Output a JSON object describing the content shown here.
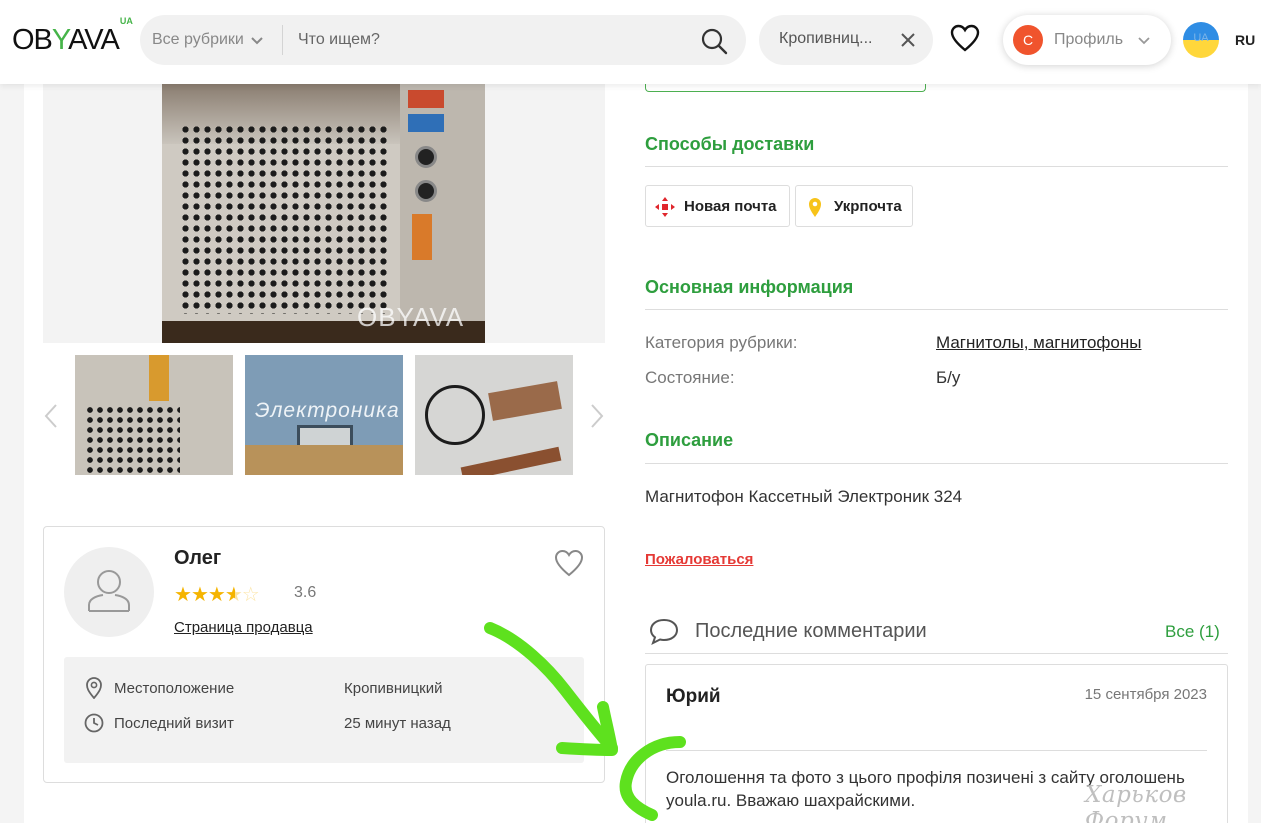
{
  "header": {
    "logo_text": "OBYAVA",
    "logo_suffix": "UA",
    "category_select": "Все рубрики",
    "search_placeholder": "Что ищем?",
    "city": "Кропивниц...",
    "profile_initial": "С",
    "profile_label": "Профиль",
    "lang_flag_text": "UA",
    "lang": "RU"
  },
  "gallery": {
    "watermark": "OBYAVA",
    "thumb2_label": "Электроника"
  },
  "seller": {
    "name": "Олег",
    "rating": "3.6",
    "rating_value": 3.6,
    "rating_max": 5,
    "page_link": "Страница продавца",
    "location_label": "Местоположение",
    "location_value": "Кропивницкий",
    "last_visit_label": "Последний визит",
    "last_visit_value": "25 минут назад"
  },
  "delivery": {
    "title": "Способы доставки",
    "options": [
      "Новая почта",
      "Укрпочта"
    ]
  },
  "info": {
    "title": "Основная информация",
    "category_label": "Категория рубрики:",
    "category_value": "Магнитолы, магнитофоны",
    "condition_label": "Состояние:",
    "condition_value": "Б/у"
  },
  "description": {
    "title": "Описание",
    "text": "Магнитофон Кассетный Электроник 324"
  },
  "report_link": "Пожаловаться",
  "comments": {
    "title": "Последние комментарии",
    "all_link": "Все (1)",
    "items": [
      {
        "author": "Юрий",
        "date": "15 сентября 2023",
        "text": "Оголошення та фото з цього профіля позичені з сайту оголошень youla.ru. Вважаю шахрайскими."
      }
    ]
  },
  "overlay": {
    "forum_watermark": "Харьков Форум",
    "arrow_color": "#5ee11e"
  },
  "colors": {
    "accent_green": "#2e9e3e",
    "star": "#f5b400",
    "report_red": "#e53935",
    "profile_avatar": "#f0542d"
  }
}
